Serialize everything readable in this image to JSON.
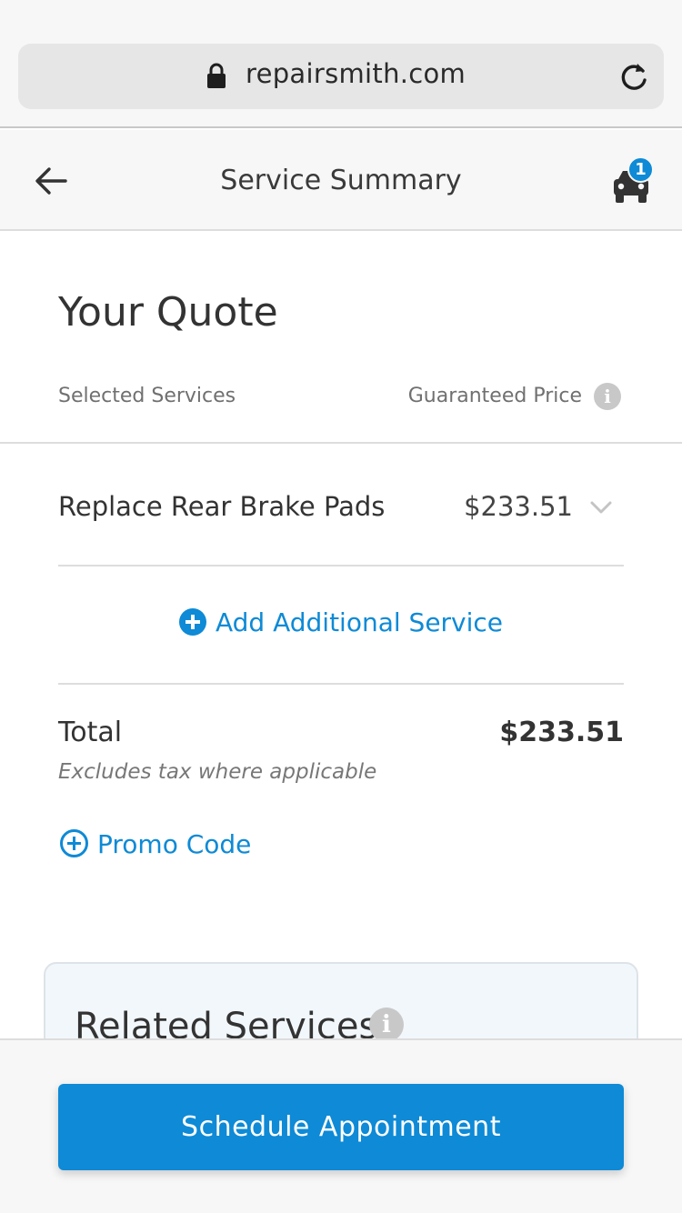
{
  "browser": {
    "url": "repairsmith.com",
    "lock_icon": "lock-icon",
    "reload_icon": "reload-icon"
  },
  "header": {
    "title": "Service Summary",
    "back_icon": "arrow-left-icon",
    "cart_icon": "car-icon",
    "cart_count": "1"
  },
  "quote": {
    "title": "Your Quote",
    "col_left": "Selected Services",
    "col_right": "Guaranteed Price",
    "info_glyph": "i",
    "services": [
      {
        "name": "Replace Rear Brake Pads",
        "price": "$233.51"
      }
    ],
    "add_service_label": "Add Additional Service",
    "total_label": "Total",
    "total_value": "$233.51",
    "tax_note": "Excludes tax where applicable",
    "promo_label": "Promo Code"
  },
  "related": {
    "title": "Related Services",
    "info_glyph": "i"
  },
  "footer": {
    "schedule_label": "Schedule Appointment"
  },
  "colors": {
    "accent": "#0e8ad6",
    "text": "#333333",
    "muted": "#707070",
    "divider": "#dddddd"
  }
}
